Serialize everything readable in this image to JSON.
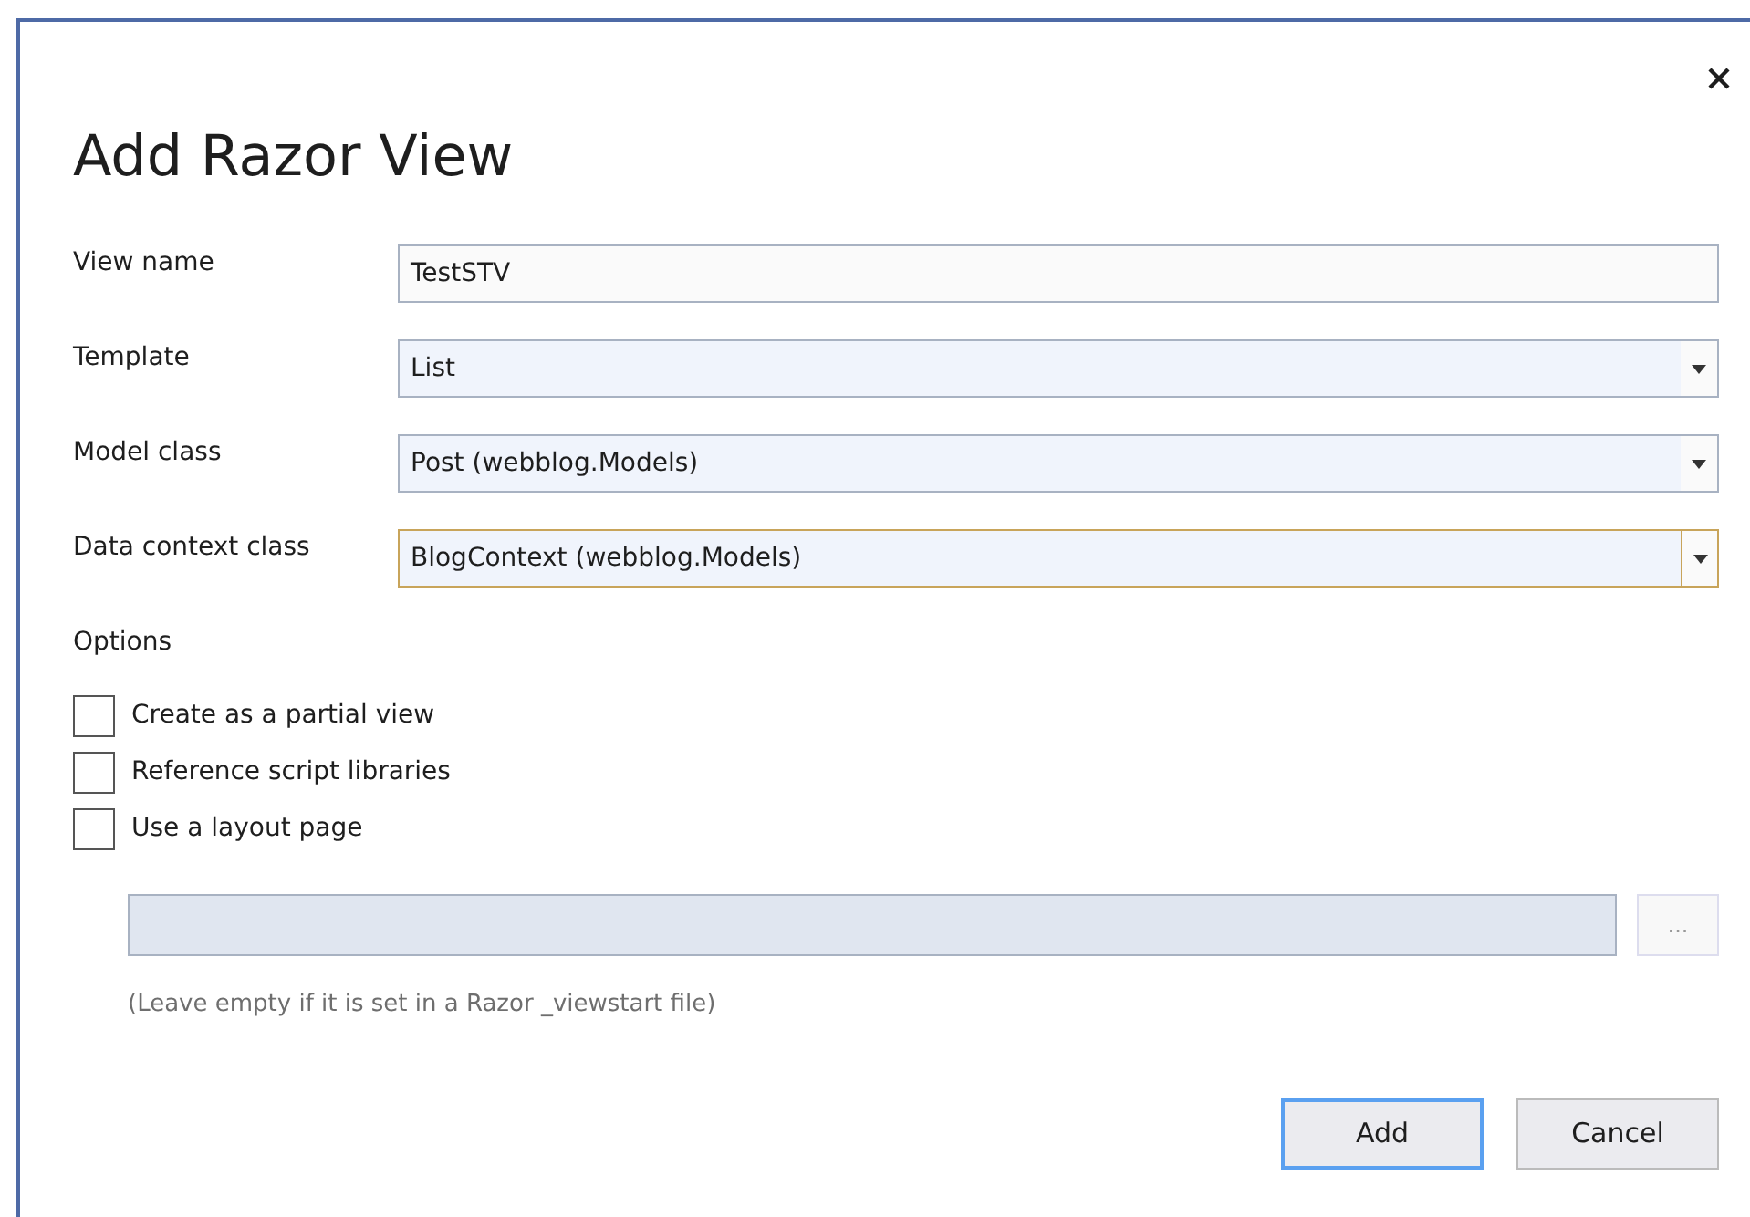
{
  "dialog": {
    "title": "Add Razor View"
  },
  "fields": [
    {
      "label": "View name",
      "kind": "text",
      "value": "TestSTV",
      "focused": false
    },
    {
      "label": "Template",
      "kind": "dropdown",
      "value": "List",
      "focused": false
    },
    {
      "label": "Model class",
      "kind": "dropdown",
      "value": "Post (webblog.Models)",
      "focused": false
    },
    {
      "label": "Data context class",
      "kind": "dropdown",
      "value": "BlogContext (webblog.Models)",
      "focused": true
    }
  ],
  "options": {
    "heading": "Options",
    "checkboxes": [
      {
        "label": "Create as a partial view",
        "checked": false
      },
      {
        "label": "Reference script libraries",
        "checked": false
      },
      {
        "label": "Use a layout page",
        "checked": false
      }
    ],
    "layout_field": {
      "disabled": true
    },
    "browse_button": {
      "label": "...",
      "disabled": true
    },
    "hint": "(Leave empty if it is set in a Razor _viewstart file)"
  },
  "buttons": [
    {
      "label": "Add",
      "default": true
    },
    {
      "label": "Cancel",
      "default": false
    }
  ]
}
